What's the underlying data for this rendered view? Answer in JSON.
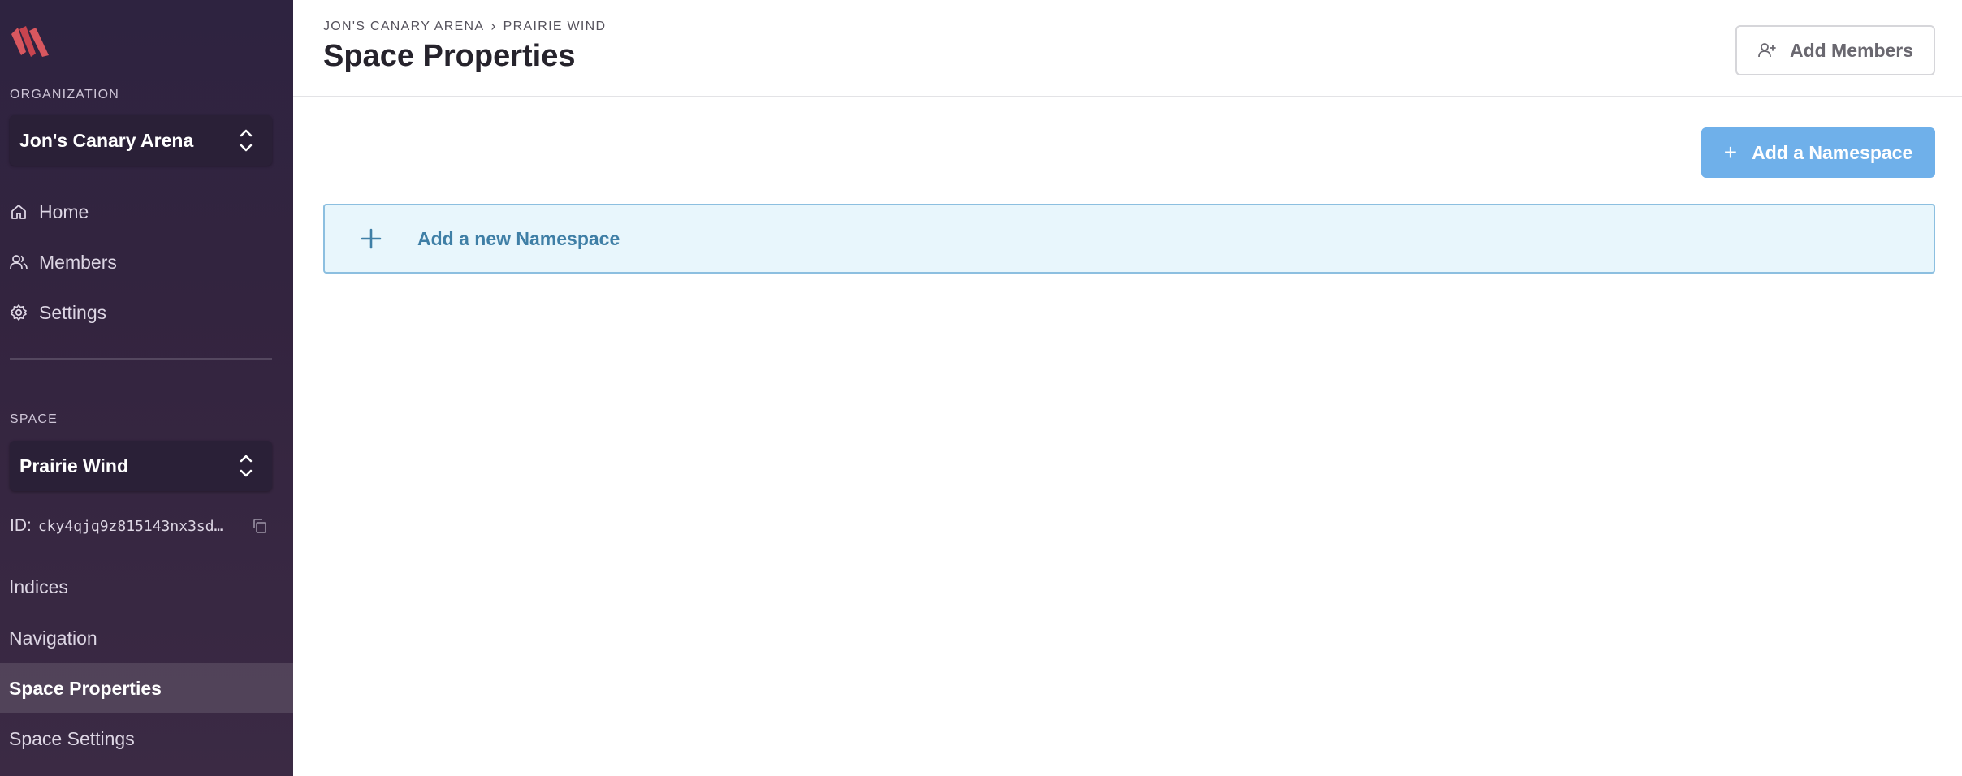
{
  "sidebar": {
    "organization_label": "ORGANIZATION",
    "organization_name": "Jon's Canary Arena",
    "nav": [
      {
        "label": "Home",
        "icon": "home-icon"
      },
      {
        "label": "Members",
        "icon": "members-icon"
      },
      {
        "label": "Settings",
        "icon": "gear-icon"
      }
    ],
    "space_label": "SPACE",
    "space_name": "Prairie Wind",
    "space_id_label": "ID:",
    "space_id": "cky4qjq9z815143nx3sd…",
    "space_links": [
      {
        "label": "Indices",
        "active": false
      },
      {
        "label": "Navigation",
        "active": false
      },
      {
        "label": "Space Properties",
        "active": true
      },
      {
        "label": "Space Settings",
        "active": false
      }
    ]
  },
  "header": {
    "breadcrumbs": [
      "JON'S CANARY ARENA",
      "PRAIRIE WIND"
    ],
    "title": "Space Properties",
    "add_members_label": "Add Members"
  },
  "main": {
    "add_namespace_label": "Add a Namespace",
    "new_namespace_label": "Add a new Namespace"
  },
  "colors": {
    "sidebar_bg": "#2e2340",
    "primary_button": "#6fb0ea",
    "new_namespace_bg": "#e8f6fc",
    "logo": "#d8575f"
  }
}
